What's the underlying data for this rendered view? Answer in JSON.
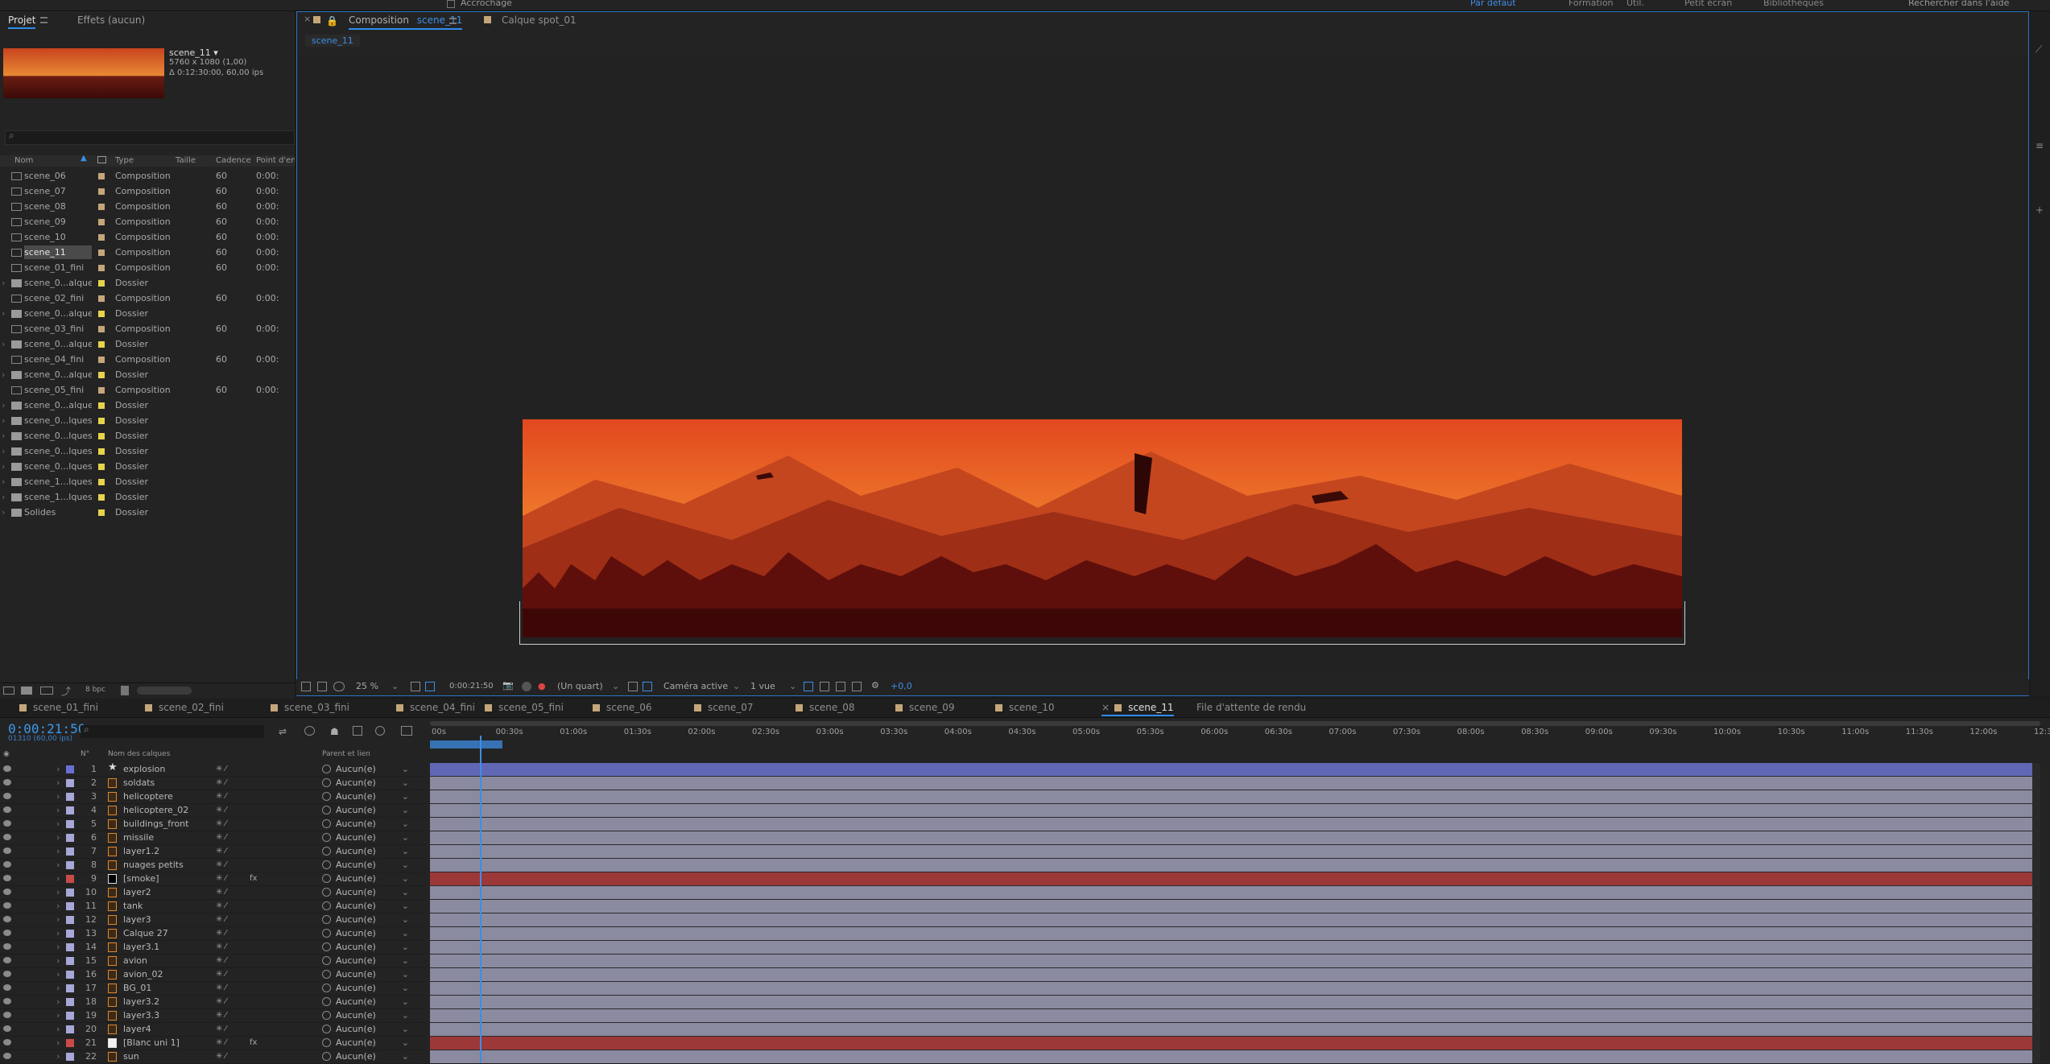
{
  "topbar": {
    "snap_label": "Accrochage",
    "workspace": [
      "Par défaut",
      "Formation",
      "Util.",
      "Petit écran",
      "Bibliothèques"
    ],
    "search": "Rechercher dans l'aide"
  },
  "project": {
    "tabs": [
      "Projet",
      "Effets (aucun)"
    ],
    "selected_name": "scene_11 ▾",
    "selected_size": "5760 x 1080 (1,00)",
    "selected_duration": "Δ 0:12:30:00, 60,00 ips",
    "columns": [
      "Nom",
      "Type",
      "Taille",
      "Cadence",
      "Point d'entr"
    ],
    "bpc": "8 bpc",
    "items": [
      {
        "name": "scene_06",
        "type": "Composition",
        "rate": "60",
        "in": "0:00:0",
        "kind": "comp",
        "color": "#c5a67a"
      },
      {
        "name": "scene_07",
        "type": "Composition",
        "rate": "60",
        "in": "0:00:0",
        "kind": "comp",
        "color": "#c5a67a"
      },
      {
        "name": "scene_08",
        "type": "Composition",
        "rate": "60",
        "in": "0:00:0",
        "kind": "comp",
        "color": "#c5a67a"
      },
      {
        "name": "scene_09",
        "type": "Composition",
        "rate": "60",
        "in": "0:00:0",
        "kind": "comp",
        "color": "#c5a67a"
      },
      {
        "name": "scene_10",
        "type": "Composition",
        "rate": "60",
        "in": "0:00:0",
        "kind": "comp",
        "color": "#c5a67a"
      },
      {
        "name": "scene_11",
        "type": "Composition",
        "rate": "60",
        "in": "0:00:0",
        "kind": "comp",
        "color": "#c5a67a",
        "selected": true
      },
      {
        "name": "scene_01_fini",
        "type": "Composition",
        "rate": "60",
        "in": "0:00:0",
        "kind": "comp",
        "color": "#c5a67a"
      },
      {
        "name": "scene_0...alques",
        "type": "Dossier",
        "rate": "",
        "in": "",
        "kind": "folder",
        "color": "#e7d34c"
      },
      {
        "name": "scene_02_fini",
        "type": "Composition",
        "rate": "60",
        "in": "0:00:0",
        "kind": "comp",
        "color": "#c5a67a"
      },
      {
        "name": "scene_0...alques",
        "type": "Dossier",
        "rate": "",
        "in": "",
        "kind": "folder",
        "color": "#e7d34c"
      },
      {
        "name": "scene_03_fini",
        "type": "Composition",
        "rate": "60",
        "in": "0:00:0",
        "kind": "comp",
        "color": "#c5a67a"
      },
      {
        "name": "scene_0...alques",
        "type": "Dossier",
        "rate": "",
        "in": "",
        "kind": "folder",
        "color": "#e7d34c"
      },
      {
        "name": "scene_04_fini",
        "type": "Composition",
        "rate": "60",
        "in": "0:00:0",
        "kind": "comp",
        "color": "#c5a67a"
      },
      {
        "name": "scene_0...alques",
        "type": "Dossier",
        "rate": "",
        "in": "",
        "kind": "folder",
        "color": "#e7d34c"
      },
      {
        "name": "scene_05_fini",
        "type": "Composition",
        "rate": "60",
        "in": "0:00:0",
        "kind": "comp",
        "color": "#c5a67a"
      },
      {
        "name": "scene_0...alques",
        "type": "Dossier",
        "rate": "",
        "in": "",
        "kind": "folder",
        "color": "#e7d34c"
      },
      {
        "name": "scene_0...lques",
        "type": "Dossier",
        "rate": "",
        "in": "",
        "kind": "folder",
        "color": "#e7d34c"
      },
      {
        "name": "scene_0...lques",
        "type": "Dossier",
        "rate": "",
        "in": "",
        "kind": "folder",
        "color": "#e7d34c"
      },
      {
        "name": "scene_0...lques",
        "type": "Dossier",
        "rate": "",
        "in": "",
        "kind": "folder",
        "color": "#e7d34c"
      },
      {
        "name": "scene_0...lques",
        "type": "Dossier",
        "rate": "",
        "in": "",
        "kind": "folder",
        "color": "#e7d34c"
      },
      {
        "name": "scene_1...lques",
        "type": "Dossier",
        "rate": "",
        "in": "",
        "kind": "folder",
        "color": "#e7d34c"
      },
      {
        "name": "scene_1...lques",
        "type": "Dossier",
        "rate": "",
        "in": "",
        "kind": "folder",
        "color": "#e7d34c"
      },
      {
        "name": "Solides",
        "type": "Dossier",
        "rate": "",
        "in": "",
        "kind": "folder",
        "color": "#e7d34c"
      }
    ]
  },
  "comp": {
    "tab_label": "Composition",
    "tab_comp": "scene_11",
    "layer_tab": "Calque spot_01",
    "breadcrumb": "scene_11",
    "zoom": "25 %",
    "timecode": "0:00:21:50",
    "resolution": "(Un quart)",
    "camera": "Caméra active",
    "views": "1 vue",
    "exposure": "+0,0"
  },
  "timeline": {
    "tabs": [
      "scene_01_fini",
      "scene_02_fini",
      "scene_03_fini",
      "scene_04_fini",
      "scene_05_fini",
      "scene_06",
      "scene_07",
      "scene_08",
      "scene_09",
      "scene_10",
      "scene_11",
      "File d'attente de rendu"
    ],
    "active_tab": "scene_11",
    "timecode": "0:00:21:50",
    "fps": "01310 (60,00 ips)",
    "header": {
      "num": "N°",
      "name": "Nom des calques",
      "parent": "Parent et lien"
    },
    "ruler": [
      "00s",
      "00:30s",
      "01:00s",
      "01:30s",
      "02:00s",
      "02:30s",
      "03:00s",
      "03:30s",
      "04:00s",
      "04:30s",
      "05:00s",
      "05:30s",
      "06:00s",
      "06:30s",
      "07:00s",
      "07:30s",
      "08:00s",
      "08:30s",
      "09:00s",
      "09:30s",
      "10:00s",
      "10:30s",
      "11:00s",
      "11:30s",
      "12:00s",
      "12:3"
    ],
    "layers": [
      {
        "num": "1",
        "name": "explosion",
        "type": "star",
        "label": "#6a6fd1",
        "parent": "Aucun(e)",
        "bar": "blue",
        "fx": ""
      },
      {
        "num": "2",
        "name": "soldats",
        "type": "shape",
        "label": "#a7a7d8",
        "parent": "Aucun(e)",
        "bar": "grey",
        "fx": ""
      },
      {
        "num": "3",
        "name": "helicoptere",
        "type": "shape",
        "label": "#a7a7d8",
        "parent": "Aucun(e)",
        "bar": "grey",
        "fx": ""
      },
      {
        "num": "4",
        "name": "helicoptere_02",
        "type": "shape",
        "label": "#a7a7d8",
        "parent": "Aucun(e)",
        "bar": "grey",
        "fx": ""
      },
      {
        "num": "5",
        "name": "buildings_front",
        "type": "shape",
        "label": "#a7a7d8",
        "parent": "Aucun(e)",
        "bar": "grey",
        "fx": ""
      },
      {
        "num": "6",
        "name": "missile",
        "type": "shape",
        "label": "#a7a7d8",
        "parent": "Aucun(e)",
        "bar": "grey",
        "fx": ""
      },
      {
        "num": "7",
        "name": "layer1.2",
        "type": "shape",
        "label": "#a7a7d8",
        "parent": "Aucun(e)",
        "bar": "grey",
        "fx": ""
      },
      {
        "num": "8",
        "name": "nuages petits",
        "type": "shape",
        "label": "#a7a7d8",
        "parent": "Aucun(e)",
        "bar": "grey",
        "fx": ""
      },
      {
        "num": "9",
        "name": "[smoke]",
        "type": "solid-black",
        "label": "#c94a4a",
        "parent": "Aucun(e)",
        "bar": "red",
        "fx": "fx"
      },
      {
        "num": "10",
        "name": "layer2",
        "type": "shape",
        "label": "#a7a7d8",
        "parent": "Aucun(e)",
        "bar": "grey",
        "fx": ""
      },
      {
        "num": "11",
        "name": "tank",
        "type": "shape",
        "label": "#a7a7d8",
        "parent": "Aucun(e)",
        "bar": "grey",
        "fx": ""
      },
      {
        "num": "12",
        "name": "layer3",
        "type": "shape",
        "label": "#a7a7d8",
        "parent": "Aucun(e)",
        "bar": "grey",
        "fx": ""
      },
      {
        "num": "13",
        "name": "Calque 27",
        "type": "shape",
        "label": "#a7a7d8",
        "parent": "Aucun(e)",
        "bar": "grey",
        "fx": ""
      },
      {
        "num": "14",
        "name": "layer3.1",
        "type": "shape",
        "label": "#a7a7d8",
        "parent": "Aucun(e)",
        "bar": "grey",
        "fx": ""
      },
      {
        "num": "15",
        "name": "avion",
        "type": "shape",
        "label": "#a7a7d8",
        "parent": "Aucun(e)",
        "bar": "grey",
        "fx": ""
      },
      {
        "num": "16",
        "name": "avion_02",
        "type": "shape",
        "label": "#a7a7d8",
        "parent": "Aucun(e)",
        "bar": "grey",
        "fx": ""
      },
      {
        "num": "17",
        "name": "BG_01",
        "type": "shape",
        "label": "#a7a7d8",
        "parent": "Aucun(e)",
        "bar": "grey",
        "fx": ""
      },
      {
        "num": "18",
        "name": "layer3.2",
        "type": "shape",
        "label": "#a7a7d8",
        "parent": "Aucun(e)",
        "bar": "grey",
        "fx": ""
      },
      {
        "num": "19",
        "name": "layer3.3",
        "type": "shape",
        "label": "#a7a7d8",
        "parent": "Aucun(e)",
        "bar": "grey",
        "fx": ""
      },
      {
        "num": "20",
        "name": "layer4",
        "type": "shape",
        "label": "#a7a7d8",
        "parent": "Aucun(e)",
        "bar": "grey",
        "fx": ""
      },
      {
        "num": "21",
        "name": "[Blanc uni 1]",
        "type": "solid",
        "label": "#c94a4a",
        "parent": "Aucun(e)",
        "bar": "red",
        "fx": "fx"
      },
      {
        "num": "22",
        "name": "sun",
        "type": "shape",
        "label": "#a7a7d8",
        "parent": "Aucun(e)",
        "bar": "grey",
        "fx": ""
      }
    ]
  },
  "colors": {
    "accent": "#2d8ceb",
    "timecode": "#3d9ae8",
    "comp_bar": "#c5a67a",
    "folder": "#e7d34c"
  }
}
